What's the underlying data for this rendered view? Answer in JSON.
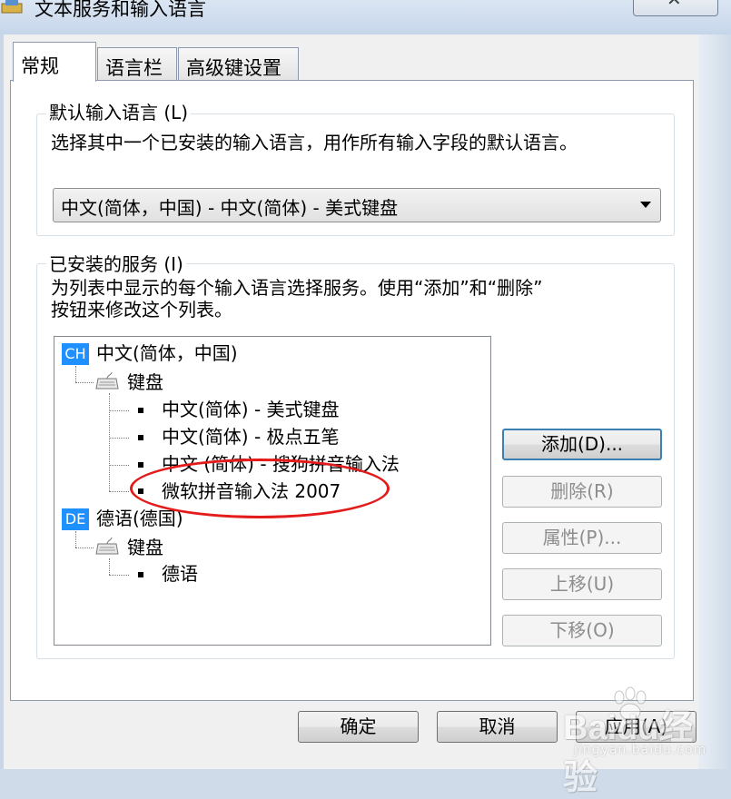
{
  "window": {
    "title": "文本服务和输入语言"
  },
  "tabs": [
    {
      "label": "常规",
      "active": true
    },
    {
      "label": "语言栏",
      "active": false
    },
    {
      "label": "高级键设置",
      "active": false
    }
  ],
  "default_language": {
    "legend": "默认输入语言 (L)",
    "description": "选择其中一个已安装的输入语言，用作所有输入字段的默认语言。",
    "selected": "中文(简体，中国) - 中文(简体) - 美式键盘"
  },
  "installed_services": {
    "legend": "已安装的服务 (I)",
    "description_line1": "为列表中显示的每个输入语言选择服务。使用“添加”和“删除”",
    "description_line2": "按钮来修改这个列表。",
    "tree": {
      "lang1": {
        "badge": "CH",
        "name": "中文(简体，中国)",
        "group": "键盘",
        "items": [
          "中文(简体) - 美式键盘",
          "中文(简体) - 极点五笔",
          "中文 (简体) - 搜狗拼音输入法",
          "微软拼音输入法 2007"
        ]
      },
      "lang2": {
        "badge": "DE",
        "name": "德语(德国)",
        "group": "键盘",
        "items": [
          "德语"
        ]
      }
    },
    "buttons": {
      "add": "添加(D)...",
      "remove": "删除(R)",
      "properties": "属性(P)...",
      "move_up": "上移(U)",
      "move_down": "下移(O)"
    }
  },
  "footer": {
    "ok": "确定",
    "cancel": "取消",
    "apply": "应用(A)"
  },
  "watermark": {
    "main": "Baidu经验",
    "sub": "jingyan.baidu.com"
  },
  "colors": {
    "highlight": "#e31b1b",
    "badge": "#1e90ff"
  }
}
